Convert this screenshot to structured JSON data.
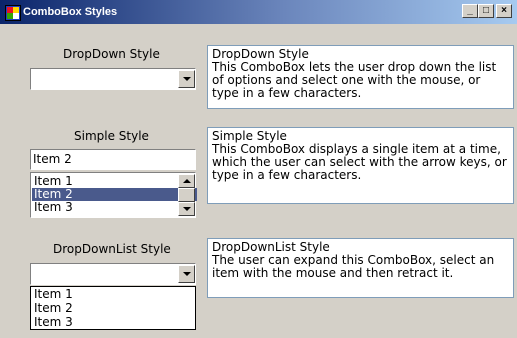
{
  "window": {
    "title": "ComboBox Styles",
    "minimize_glyph": "_",
    "maximize_glyph": "□",
    "close_glyph": "×"
  },
  "sections": [
    {
      "label": "DropDown Style",
      "combo_value": "",
      "description": "DropDown Style\nThis ComboBox lets the user drop down the list of options and select one with the mouse, or type in a few characters."
    },
    {
      "label": "Simple Style",
      "combo_value": "Item 2",
      "list_items": [
        "Item 1",
        "Item 2",
        "Item 3"
      ],
      "selected_index": 1,
      "description": "Simple Style\nThis ComboBox displays a single item at a time, which the user can select with the arrow keys, or type in a few characters."
    },
    {
      "label": "DropDownList Style",
      "combo_value": "",
      "list_items": [
        "Item 1",
        "Item 2",
        "Item 3"
      ],
      "description": "DropDownList Style\nThe user can expand this ComboBox, select an item with the mouse and then retract it."
    }
  ],
  "colors": {
    "titlebar_start": "#0a246a",
    "titlebar_end": "#a6caf0",
    "selection": "#4a5a8c",
    "face": "#d4d0c8"
  }
}
